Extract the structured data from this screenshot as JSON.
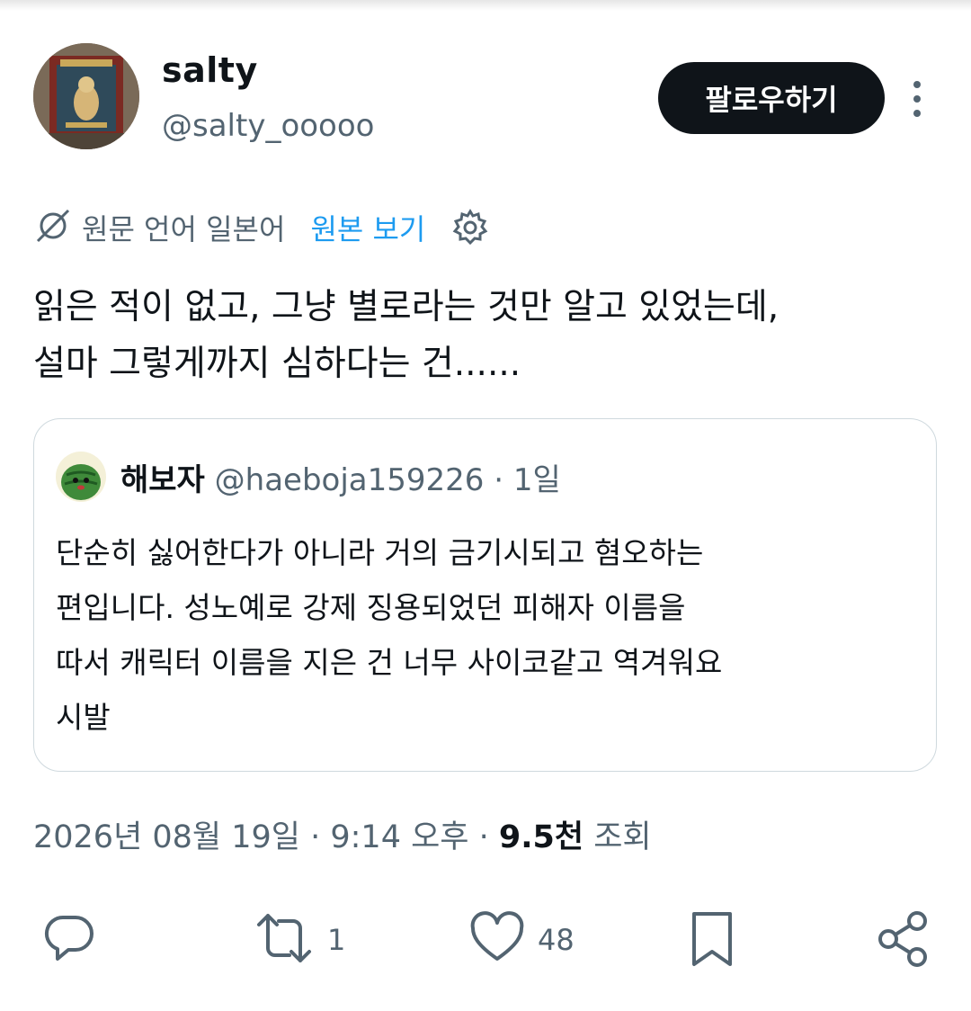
{
  "author": {
    "name": "salty",
    "handle": "@salty_ooooo"
  },
  "follow_label": "팔로우하기",
  "translation": {
    "source_lang": "원문 언어 일본어",
    "show_original": "원본 보기"
  },
  "tweet_text": "읽은 적이 없고, 그냥 별로라는 것만 알고 있었는데,\n설마 그렇게까지 심하다는 건......",
  "quote": {
    "name": "해보자",
    "handle_time": "@haeboja159226 · 1일",
    "text": "단순히 싫어한다가 아니라 거의 금기시되고 혐오하는\n편입니다. 성노예로 강제 징용되었던 피해자 이름을\n따서 캐릭터 이름을 지은 건 너무 사이코같고 역겨워요\n시발"
  },
  "meta": {
    "datetime": "2026년 08월 19일 · 9:14 오후 · ",
    "views_count": "9.5천",
    "views_label": " 조회"
  },
  "actions": {
    "retweets": "1",
    "likes": "48"
  },
  "colors": {
    "link": "#1d9bf0",
    "muted": "#536471",
    "text": "#0f1419",
    "button_bg": "#0f1419"
  },
  "icons": [
    "translate-icon",
    "gear-icon",
    "more-icon",
    "reply-icon",
    "retweet-icon",
    "like-icon",
    "bookmark-icon",
    "share-icon"
  ]
}
